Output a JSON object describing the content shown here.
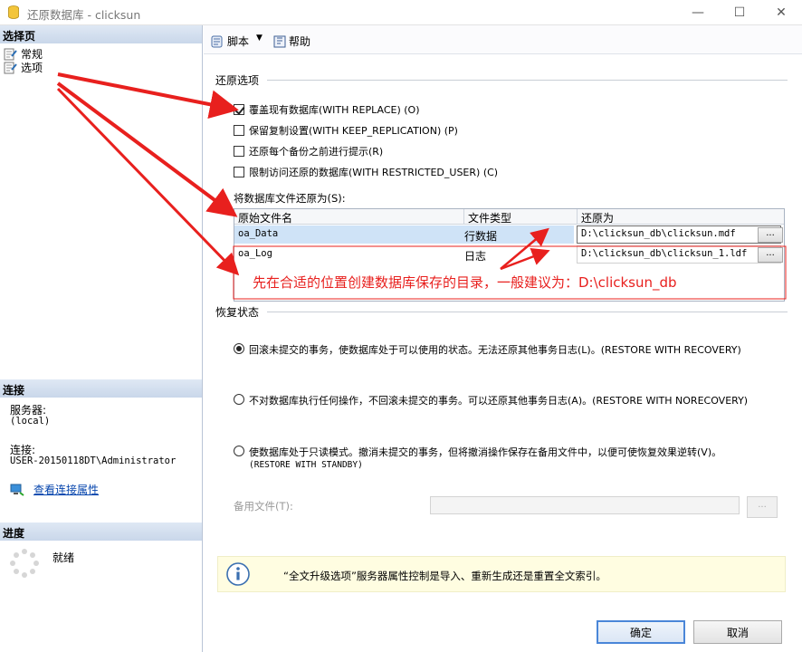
{
  "window": {
    "title": "还原数据库 - clicksun",
    "minimize": "—",
    "maximize": "☐",
    "close": "✕"
  },
  "left": {
    "select_page_header": "选择页",
    "pages": [
      {
        "label": "常规",
        "icon": "page-settings-icon"
      },
      {
        "label": "选项",
        "icon": "page-settings-icon"
      }
    ],
    "connection_header": "连接",
    "server_label": "服务器:",
    "server_value": "(local)",
    "connection_label": "连接:",
    "connection_value": "USER-20150118DT\\Administrator",
    "view_conn_props": "查看连接属性",
    "progress_header": "进度",
    "progress_status": "就绪"
  },
  "toolbar": {
    "script_label": "脚本",
    "help_label": "帮助"
  },
  "restore_options": {
    "section_label": "还原选项",
    "options": [
      {
        "label": "覆盖现有数据库(WITH REPLACE) (O)",
        "checked": true
      },
      {
        "label": "保留复制设置(WITH KEEP_REPLICATION) (P)",
        "checked": false
      },
      {
        "label": "还原每个备份之前进行提示(R)",
        "checked": false
      },
      {
        "label": "限制访问还原的数据库(WITH RESTRICTED_USER) (C)",
        "checked": false
      }
    ]
  },
  "files": {
    "label": "将数据库文件还原为(S):",
    "columns": [
      "原始文件名",
      "文件类型",
      "还原为"
    ],
    "rows": [
      {
        "name": "oa_Data",
        "type": "行数据",
        "path": "D:\\clicksun_db\\clicksun.mdf"
      },
      {
        "name": "oa_Log",
        "type": "日志",
        "path": "D:\\clicksun_db\\clicksun_1.ldf"
      }
    ],
    "browse_label": "..."
  },
  "recovery": {
    "section_label": "恢复状态",
    "options": [
      {
        "line1": "回滚未提交的事务，使数据库处于可以使用的状态。无法还原其他事务日志(L)。(RESTORE WITH RECOVERY)",
        "line2": "",
        "checked": true
      },
      {
        "line1": "不对数据库执行任何操作，不回滚未提交的事务。可以还原其他事务日志(A)。(RESTORE WITH NORECOVERY)",
        "line2": "",
        "checked": false
      },
      {
        "line1": "使数据库处于只读模式。撤消未提交的事务，但将撤消操作保存在备用文件中，以便可使恢复效果逆转(V)。",
        "line2": "(RESTORE WITH STANDBY)",
        "checked": false
      }
    ],
    "standby_label": "备用文件(T):",
    "standby_value": "",
    "standby_browse": "..."
  },
  "info": {
    "text": "“全文升级选项”服务器属性控制是导入、重新生成还是重置全文索引。"
  },
  "footer": {
    "ok_label": "确定",
    "cancel_label": "取消"
  },
  "annotation": {
    "text": "先在合适的位置创建数据库保存的目录，一般建议为：D:\\clicksun_db",
    "color": "#e8201e"
  },
  "colors": {
    "accent": "#4a86d8",
    "pane_header": "#c9d7ea",
    "selection": "#cfe3f7",
    "info_bg": "#fffde1"
  }
}
